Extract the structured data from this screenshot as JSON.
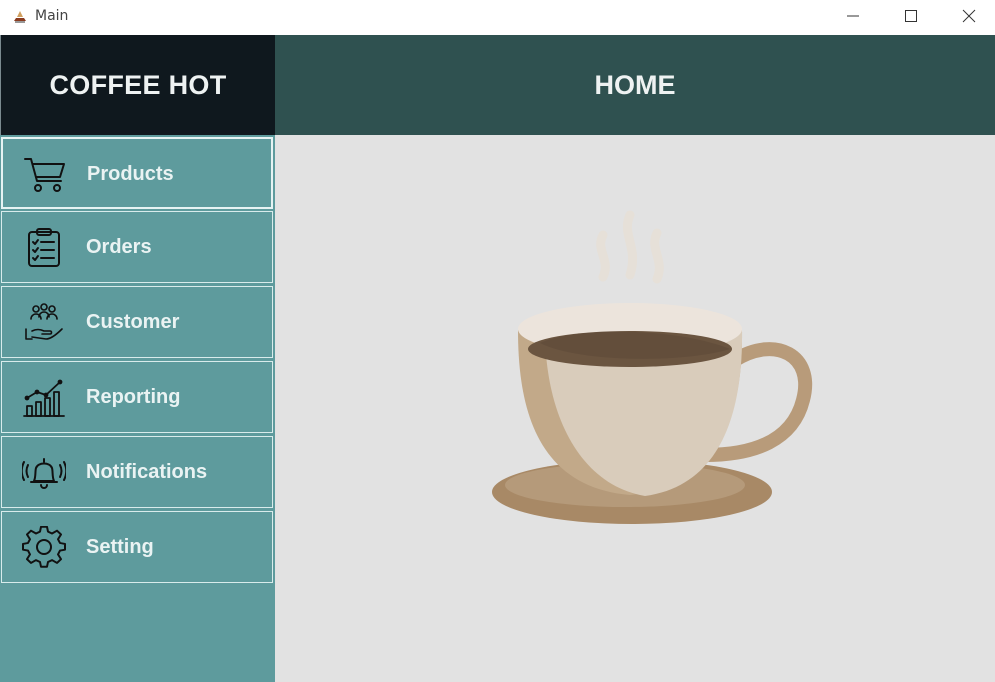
{
  "window": {
    "title": "Main",
    "controls": [
      "minimize-icon",
      "maximize-icon",
      "close-icon"
    ]
  },
  "brand": {
    "title": "COFFEE HOT"
  },
  "header": {
    "title": "HOME"
  },
  "sidebar": {
    "items": [
      {
        "label": "Products",
        "icon": "cart-icon",
        "active": true
      },
      {
        "label": "Orders",
        "icon": "clipboard-checklist-icon"
      },
      {
        "label": "Customer",
        "icon": "customers-hand-icon"
      },
      {
        "label": "Reporting",
        "icon": "bar-chart-icon"
      },
      {
        "label": "Notifications",
        "icon": "ringing-bell-icon"
      },
      {
        "label": "Setting",
        "icon": "gear-icon"
      }
    ]
  },
  "content": {
    "illustration": "coffee-cup-illustration"
  },
  "colors": {
    "brand_bg": "#0f181e",
    "header_bg": "#2f5150",
    "sidebar_bg": "#5e9b9d",
    "content_bg": "#e2e2e2"
  }
}
